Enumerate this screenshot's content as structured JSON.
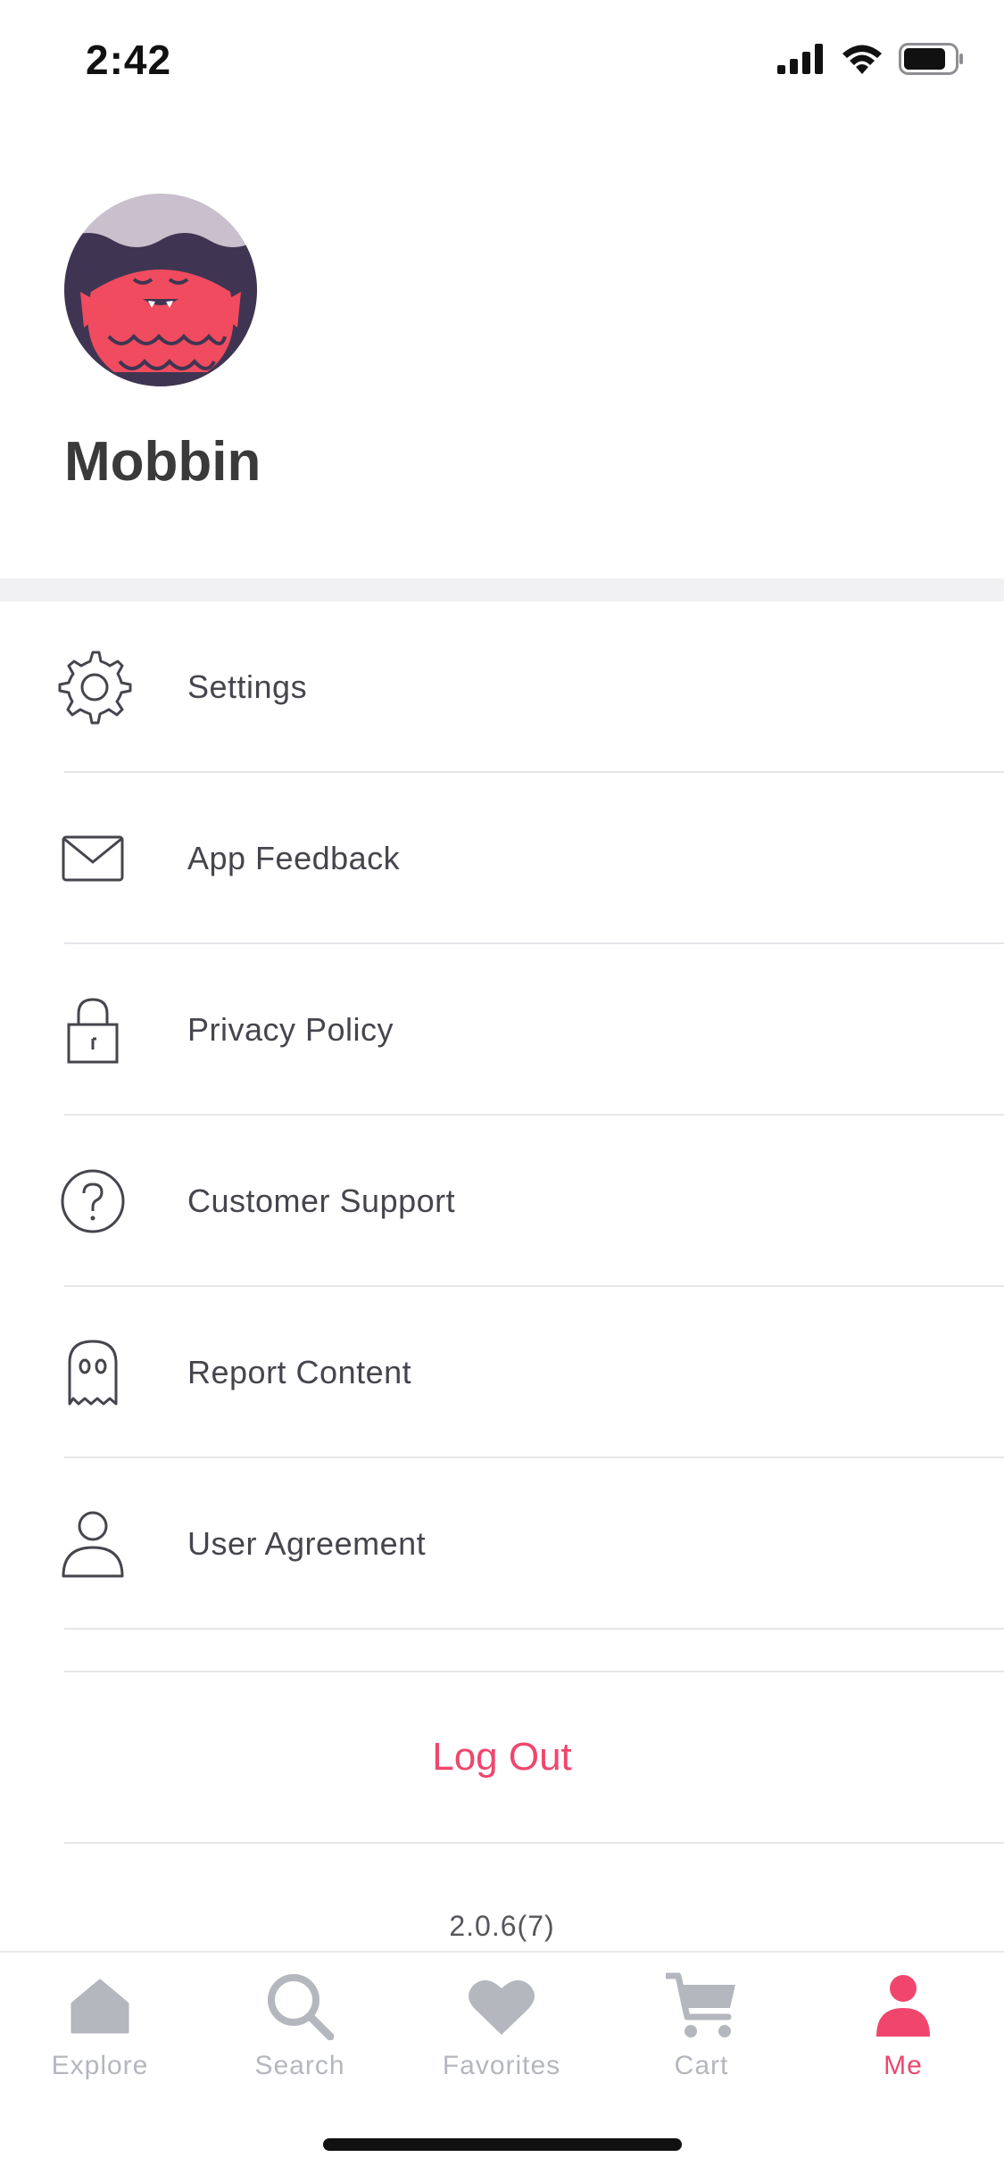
{
  "status_bar": {
    "time": "2:42"
  },
  "profile": {
    "name": "Mobbin",
    "avatar_icon": "fish-monster-avatar"
  },
  "menu": {
    "items": [
      {
        "label": "Settings",
        "icon": "gear-icon"
      },
      {
        "label": "App Feedback",
        "icon": "envelope-icon"
      },
      {
        "label": "Privacy Policy",
        "icon": "lock-icon"
      },
      {
        "label": "Customer Support",
        "icon": "question-circle-icon"
      },
      {
        "label": "Report Content",
        "icon": "ghost-icon"
      },
      {
        "label": "User Agreement",
        "icon": "user-icon"
      }
    ]
  },
  "logout_label": "Log Out",
  "version": "2.0.6(7)",
  "tab_bar": {
    "tabs": [
      {
        "label": "Explore",
        "icon": "home-icon",
        "active": false
      },
      {
        "label": "Search",
        "icon": "search-icon",
        "active": false
      },
      {
        "label": "Favorites",
        "icon": "heart-icon",
        "active": false
      },
      {
        "label": "Cart",
        "icon": "cart-icon",
        "active": false
      },
      {
        "label": "Me",
        "icon": "person-icon",
        "active": true
      }
    ]
  },
  "colors": {
    "accent": "#f0466e",
    "tab_inactive": "#b4b7bd",
    "text": "#45454d"
  }
}
